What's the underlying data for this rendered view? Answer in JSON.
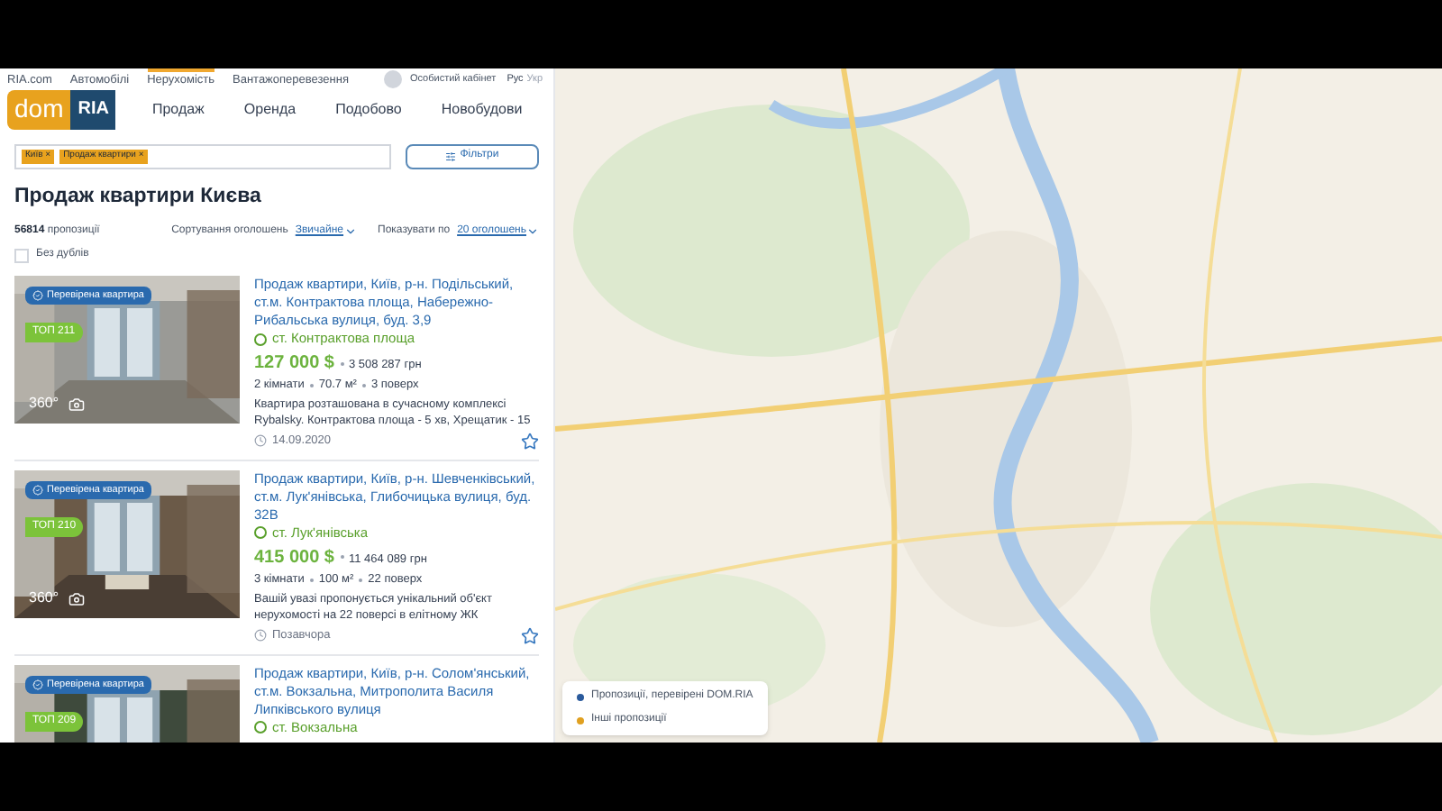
{
  "top_menu": [
    {
      "label": "RIA.com",
      "selected": false
    },
    {
      "label": "Автомобілі",
      "selected": false
    },
    {
      "label": "Нерухомість",
      "selected": true
    },
    {
      "label": "Вантажоперевезення",
      "selected": false
    }
  ],
  "account": "Особистий кабінет",
  "languages": [
    {
      "label": "Рус",
      "selected": true
    },
    {
      "label": "Укр",
      "selected": false
    }
  ],
  "logo": {
    "left": "dom",
    "right": "RIA"
  },
  "nav": [
    {
      "label": "Продаж"
    },
    {
      "label": "Оренда"
    },
    {
      "label": "Подобово"
    },
    {
      "label": "Новобудови"
    }
  ],
  "search": {
    "tags": [
      {
        "label": "Київ",
        "remove": "×"
      },
      {
        "label": "Продаж квартири",
        "remove": "×"
      }
    ],
    "filters_button": "Фільтри"
  },
  "heading": "Продаж квартири Києва",
  "count": {
    "number": "56814",
    "label": "пропозиції"
  },
  "sort": {
    "label": "Сортування оголошень",
    "value": "Звичайне"
  },
  "per_page": {
    "label": "Показувати по",
    "value": "20 оголошень"
  },
  "no_duplicates": {
    "label": "Без дублів",
    "checked": false
  },
  "listings": [
    {
      "verified": "Перевірена квартира",
      "top": "ТОП 211",
      "pano": "360°",
      "title": "Продаж квартири, Київ, р-н. Подільський, ст.м. Контрактова площа, Набережно-Рибальська вулиця, буд. 3,9",
      "metro": "ст. Контрактова площа",
      "price": "127 000 $",
      "price_uah": "3 508 287 грн",
      "rooms": "2 кімнати",
      "area": "70.7 м²",
      "floor": "3 поверх",
      "description": "Квартира розташована в сучасному комплексі Rybalsky. Контрактова площа - 5 хв, Хрещатик - 15",
      "date": "14.09.2020",
      "favorite": false
    },
    {
      "verified": "Перевірена квартира",
      "top": "ТОП 210",
      "pano": "360°",
      "title": "Продаж квартири, Київ, р-н. Шевченківський, ст.м. Лук'янівська, Глибочицька вулиця, буд. 32В",
      "metro": "ст. Лук'янівська",
      "price": "415 000 $",
      "price_uah": "11 464 089 грн",
      "rooms": "3 кімнати",
      "area": "100 м²",
      "floor": "22 поверх",
      "description": "Вашій увазі пропонується унікальний об'єкт нерухомості на 22 поверсі в елітному ЖК",
      "date": "Позавчора",
      "favorite": false
    },
    {
      "verified": "Перевірена квартира",
      "top": "ТОП 209",
      "title": "Продаж квартири, Київ, р-н. Солом'янський, ст.м. Вокзальна, Митрополита Василя Липківського вулиця",
      "metro": "ст. Вокзальна"
    }
  ],
  "map_legend": [
    {
      "label": "Пропозиції, перевірені DOM.RIA",
      "color": "#2a5a9c"
    },
    {
      "label": "Інші пропозиції",
      "color": "#e0a020"
    }
  ]
}
